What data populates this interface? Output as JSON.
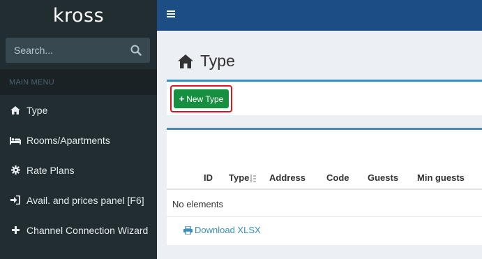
{
  "brand": {
    "logo_text": "kross"
  },
  "sidebar": {
    "search_placeholder": "Search...",
    "menu_header": "MAIN MENU",
    "items": [
      {
        "label": "Type",
        "icon": "home-icon"
      },
      {
        "label": "Rooms/Apartments",
        "icon": "bed-icon"
      },
      {
        "label": "Rate Plans",
        "icon": "gear-icon"
      },
      {
        "label": "Avail. and prices panel [F6]",
        "icon": "sign-in-icon"
      },
      {
        "label": "Channel Connection Wizard",
        "icon": "plus-icon"
      }
    ]
  },
  "page": {
    "title": "Type",
    "new_button_label": "New Type",
    "table": {
      "columns": [
        "ID",
        "Type",
        "Address",
        "Code",
        "Guests",
        "Min guests"
      ],
      "empty_text": "No elements"
    },
    "download_label": "Download XLSX"
  },
  "colors": {
    "sidebar_bg": "#222d32",
    "topbar_bg": "#1c4d84",
    "accent": "#3c8dbc",
    "button_green": "#168f40",
    "highlight_red": "#e0141e"
  }
}
